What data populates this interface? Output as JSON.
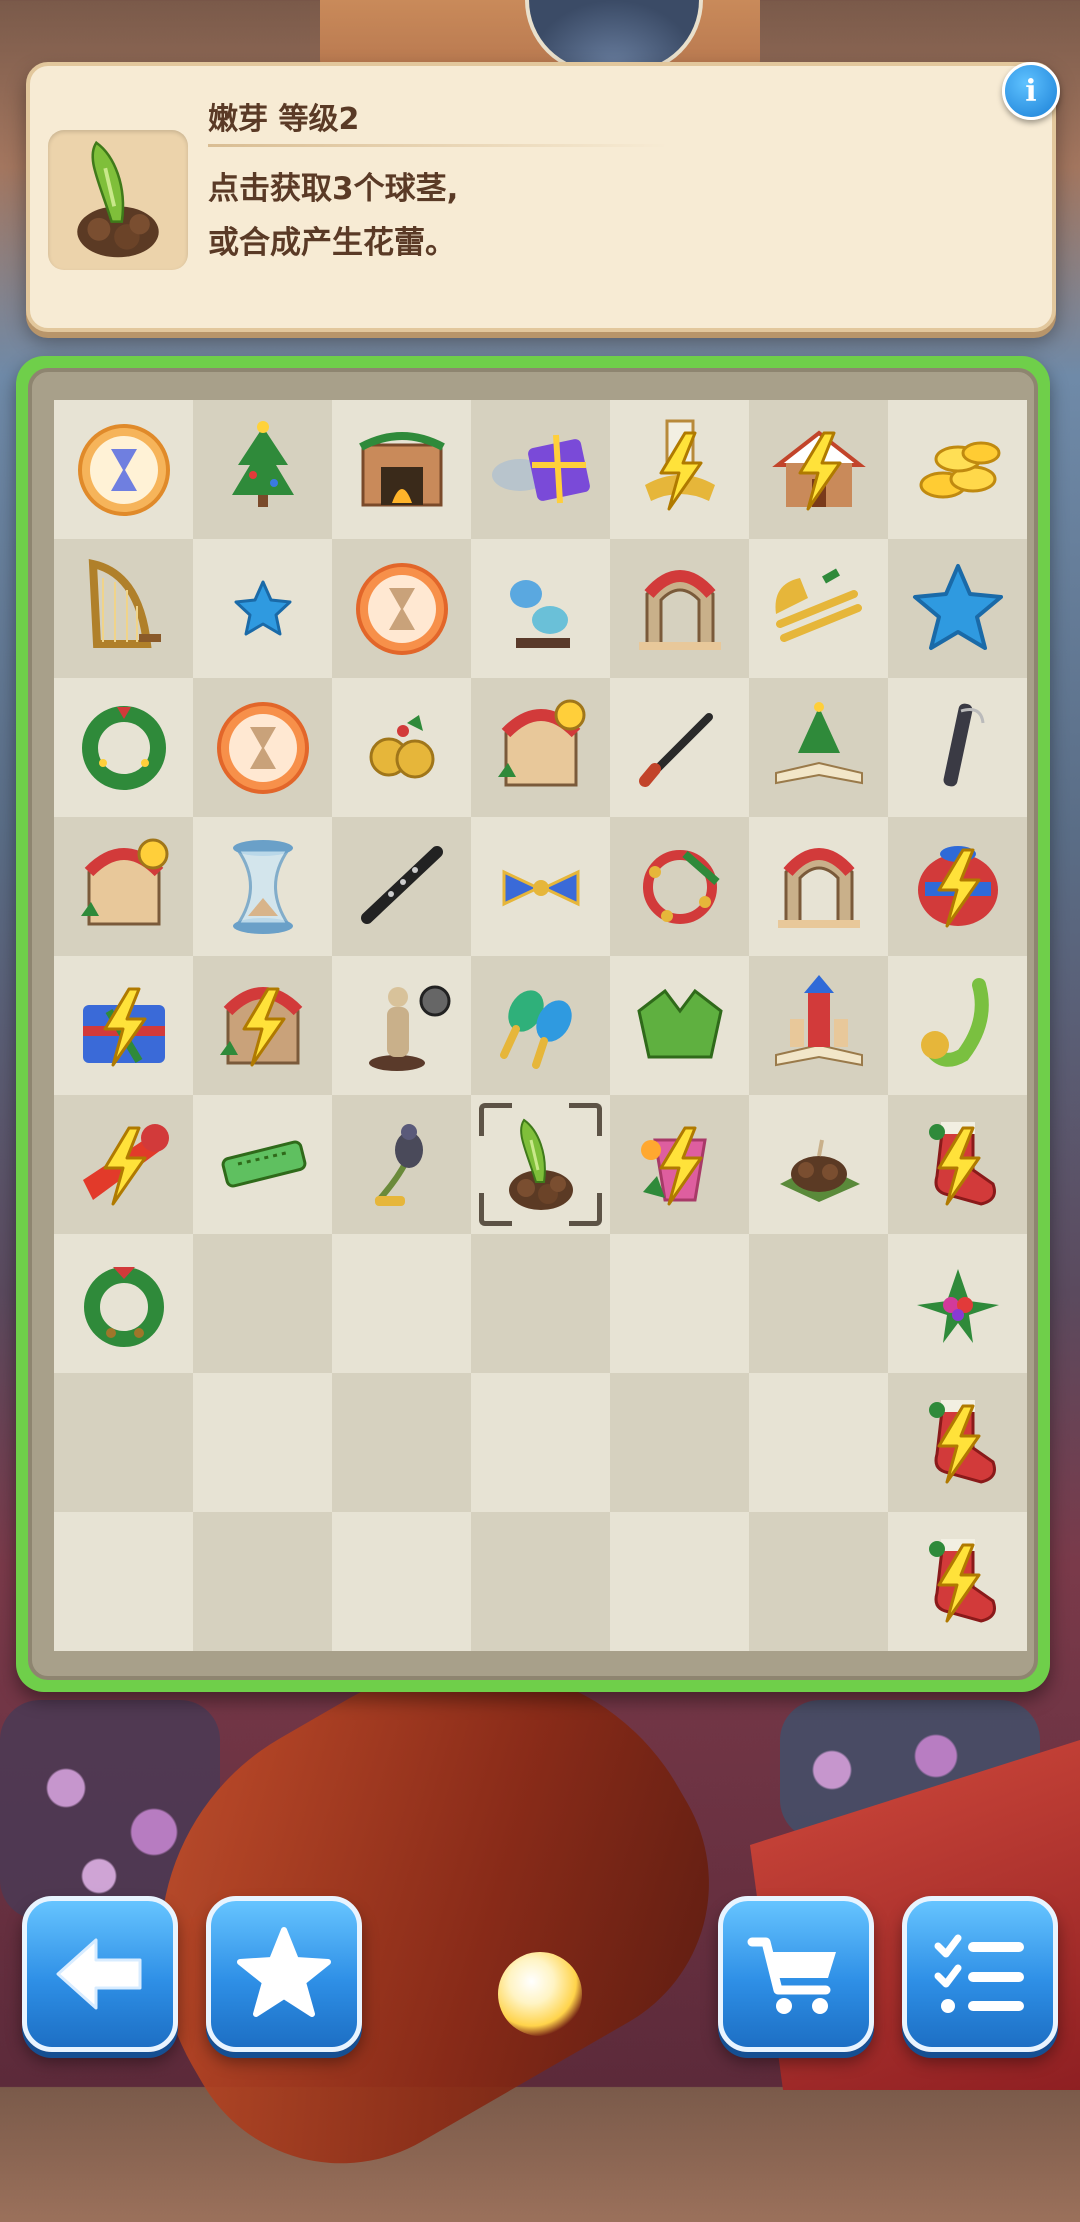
{
  "info_panel": {
    "title": "嫩芽 等级2",
    "description": "点击获取3个球茎,\n或合成产生花蕾。",
    "selected_item_icon": "sprout-bulb-icon",
    "info_button_label": "i"
  },
  "board": {
    "columns": 7,
    "rows": 9,
    "selected_cell": {
      "row": 5,
      "col": 3
    },
    "items": [
      [
        "hourglass-bubble-icon",
        "christmas-tree-icon",
        "fireplace-icon",
        "fish-gift-box-icon",
        "trumpet-energy-icon",
        "gingerbread-house-energy-icon",
        "gold-coins-icon"
      ],
      [
        "harp-icon",
        "blue-star-small-icon",
        "hourglass-bubble-orange-icon",
        "birds-figurine-icon",
        "red-arch-gate-icon",
        "trombone-icon",
        "blue-star-icon"
      ],
      [
        "christmas-wreath-icon",
        "hourglass-bubble-orange-icon",
        "jingle-bells-icon",
        "cuckoo-clock-house-icon",
        "paintbrush-icon",
        "christmas-tree-popup-book-icon",
        "bassoon-icon"
      ],
      [
        "cuckoo-clock-house-icon",
        "hourglass-icon",
        "clarinet-icon",
        "bow-tie-icon",
        "tambourine-icon",
        "red-arch-gate-icon",
        "sweater-energy-icon"
      ],
      [
        "gift-box-energy-icon",
        "cuckoo-clock-energy-icon",
        "statue-figurine-icon",
        "maracas-icon",
        "green-box-icon",
        "castle-popup-book-icon",
        "saxophone-icon"
      ],
      [
        "party-horn-energy-icon",
        "harmonica-icon",
        "bird-on-branch-icon",
        "sprout-bulb-icon",
        "drink-energy-icon",
        "bulb-roots-icon",
        "stocking-energy-icon"
      ],
      [
        "holly-wreath-icon",
        "",
        "",
        "",
        "",
        "",
        "poinsettia-icon"
      ],
      [
        "",
        "",
        "",
        "",
        "",
        "",
        "stocking-energy-icon"
      ],
      [
        "",
        "",
        "",
        "",
        "",
        "",
        "stocking-energy-icon"
      ]
    ]
  },
  "bottom_bar": {
    "back_icon": "back-arrow-icon",
    "favorites_icon": "star-icon",
    "shop_icon": "shopping-cart-icon",
    "tasks_icon": "checklist-icon"
  },
  "colors": {
    "board_border": "#6fcf4a",
    "cell_light": "#e7e3d4",
    "cell_dark": "#d6d1bf",
    "button_blue": "#2e8fe6",
    "panel_bg": "#f7ebd4",
    "text_brown": "#5a3a26"
  }
}
